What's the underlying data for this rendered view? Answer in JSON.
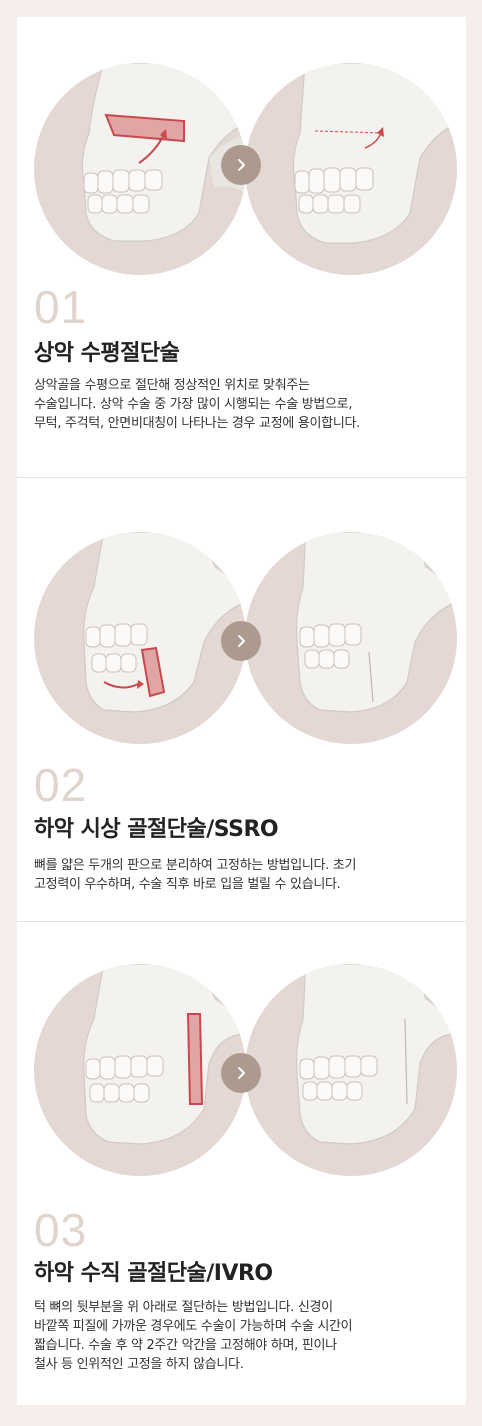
{
  "colors": {
    "page_bg": "#f6eeea",
    "card_bg": "#ffffff",
    "circle_bg": "#e3d8d3",
    "arrow_bg": "#ad9a8f",
    "number": "#e0d4cc",
    "cut_red": "#c9484c"
  },
  "sections": [
    {
      "number": "01",
      "title": "상악 수평절단술",
      "desc_lines": [
        "상악골을 수평으로 절단해 정상적인 위치로 맞춰주는",
        "수술입니다. 상악 수술 중 가장 많이 시행되는 수술 방법으로,",
        "무턱, 주걱턱, 안면비대칭이 나타나는 경우 교정에 용이합니다."
      ],
      "next_icon": "chevron-right-icon"
    },
    {
      "number": "02",
      "title": "하악 시상 골절단술/SSRO",
      "desc_lines": [
        "뼈를 얇은 두개의 판으로 분리하여 고정하는 방법입니다. 초기",
        "고정력이 우수하며, 수술 직후 바로 입을 벌릴 수 있습니다."
      ],
      "next_icon": "chevron-right-icon"
    },
    {
      "number": "03",
      "title": "하악 수직 골절단술/IVRO",
      "desc_lines": [
        "턱 뼈의 뒷부분을 위 아래로 절단하는 방법입니다. 신경이",
        "바깥쪽 피질에 가까운 경우에도 수술이 가능하며 수술 시간이",
        "짧습니다. 수술 후 약 2주간 악간을 고정해야 하며, 핀이나",
        "철사 등 인위적인 고정을 하지 않습니다."
      ],
      "next_icon": "chevron-right-icon"
    }
  ]
}
